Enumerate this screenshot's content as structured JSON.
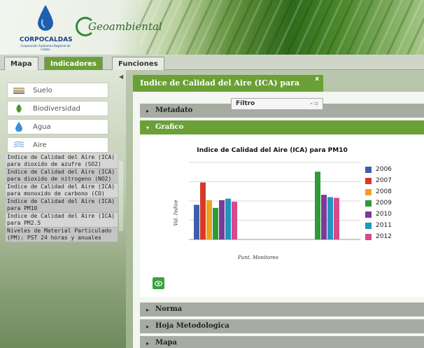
{
  "header": {
    "corp_logo_text": "CORPOCALDAS",
    "corp_logo_tagline": "Corporación Autónoma Regional de Caldas",
    "geo_logo_text": "Geoambiental"
  },
  "tabs": [
    {
      "label": "Mapa",
      "active": false
    },
    {
      "label": "Indicadores",
      "active": true
    },
    {
      "label": "Funciones",
      "active": false
    }
  ],
  "sidebar": {
    "categories": [
      {
        "label": "Suelo",
        "icon": "soil-icon"
      },
      {
        "label": "Biodiversidad",
        "icon": "leaf-icon"
      },
      {
        "label": "Agua",
        "icon": "water-drop-icon"
      },
      {
        "label": "Aire",
        "icon": "wind-icon"
      }
    ],
    "indicators": [
      "Indice de Calidad del Aire (ICA) para dioxido de azufre (SO2)",
      "Indice de Calidad del Aire (ICA) para dioxido de nitrogeno (NO2)",
      "Indice de Calidad del Aire (ICA) para monoxido de carbono (CO)",
      "Indice de Calidad del Aire (ICA) para PM10",
      "Indice de Calidad del Aire (ICA) para PM2.5",
      "Niveles de Material Particulado (PM): PST 24 horas y anuales"
    ]
  },
  "document_tab": {
    "title": "Indice de Calidad del Aire (ICA) para PM10",
    "close": "x"
  },
  "filter_window": {
    "title": "Filtro",
    "controls": "- ▫"
  },
  "sections": {
    "metadato": "Metadato",
    "grafico": "Grafico",
    "norma": "Norma",
    "hoja": "Hoja Metodologica",
    "mapa": "Mapa"
  },
  "colors": {
    "accent_green": "#6aa035",
    "section_gray": "#a6aca2"
  },
  "chart_data": {
    "type": "bar",
    "title": "Indice de Calidad del Aire (ICA) para PM10",
    "xlabel": "Punt. Monitoreo",
    "ylabel": "Val. Indice",
    "categories": [
      "",
      ""
    ],
    "ylim": [
      0,
      100
    ],
    "grid": true,
    "legend_position": "right",
    "series": [
      {
        "name": "2006",
        "color": "#3f5fa8",
        "values": [
          45,
          null
        ]
      },
      {
        "name": "2007",
        "color": "#d43a2a",
        "values": [
          74,
          null
        ]
      },
      {
        "name": "2008",
        "color": "#f0a020",
        "values": [
          51,
          null
        ]
      },
      {
        "name": "2009",
        "color": "#2f9a3a",
        "values": [
          41,
          88
        ]
      },
      {
        "name": "2010",
        "color": "#7a3a9a",
        "values": [
          51,
          58
        ]
      },
      {
        "name": "2011",
        "color": "#1f95c0",
        "values": [
          53,
          55
        ]
      },
      {
        "name": "2012",
        "color": "#d84a8a",
        "values": [
          49,
          54
        ]
      }
    ]
  }
}
